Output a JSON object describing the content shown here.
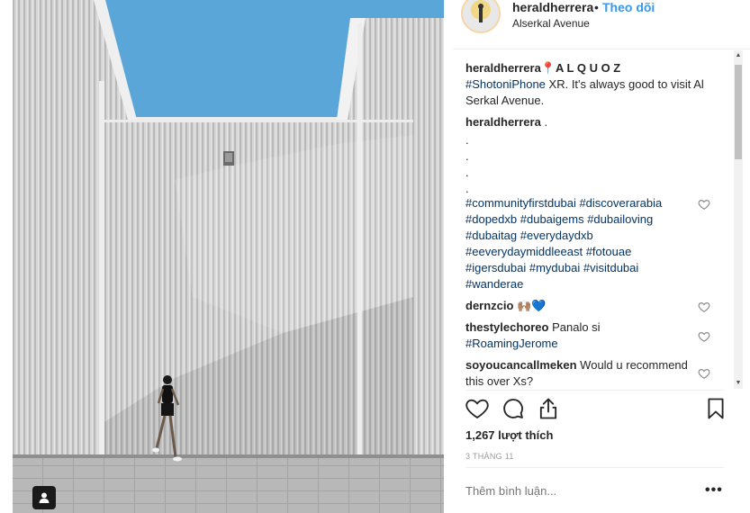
{
  "post": {
    "username": "heraldherrera",
    "dot": "•",
    "follow_label": "Theo dõi",
    "location": "Alserkal Avenue"
  },
  "caption": {
    "username": "heraldherrera",
    "pin": "📍",
    "title": "A L Q U O Z",
    "hashtag": "#ShotoniPhone",
    "text": " XR. It's always good to visit Al Serkal Avenue."
  },
  "comments": [
    {
      "username": "heraldherrera",
      "text": " ."
    },
    {
      "dots": [
        ".",
        ".",
        ".",
        "."
      ]
    },
    {
      "hashtags": [
        "#communityfirstdubai",
        "#discoverarabia",
        "#dopedxb",
        "#dubaigems",
        "#dubailoving",
        "#dubaitag",
        "#everydaydxb",
        "#eeverydaymiddleeast",
        "#fotouae",
        "#igersdubai",
        "#mydubai",
        "#visitdubai",
        "#wanderae"
      ]
    },
    {
      "username": "dernzcio",
      "emoji": "🙌🏽💙"
    },
    {
      "username": "thestylechoreo",
      "text": " Panalo si ",
      "tag": "#RoamingJerome"
    },
    {
      "username": "soyoucancallmeken",
      "text": " Would u recommend this over Xs?"
    }
  ],
  "actions": {
    "like_icon": "heart-icon",
    "comment_icon": "comment-icon",
    "share_icon": "share-icon",
    "save_icon": "bookmark-icon"
  },
  "likes_text": "1,267 lượt thích",
  "date_text": "3 THÁNG 11",
  "add_comment_placeholder": "Thêm bình luận...",
  "more_label": "•••",
  "scroll": {
    "up": "▲",
    "down": "▼"
  },
  "colors": {
    "link": "#003569",
    "follow": "#3897f0",
    "sky": "#5aa6d8"
  }
}
